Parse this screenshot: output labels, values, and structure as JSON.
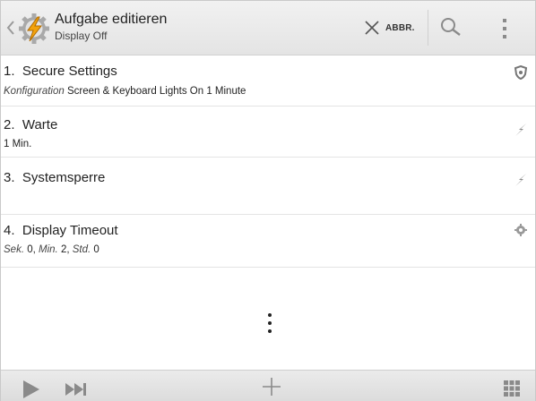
{
  "header": {
    "title": "Aufgabe editieren",
    "subtitle": "Display Off",
    "cancel_label": "ABBR.",
    "icons": [
      "back-chevron-icon",
      "tasker-logo-icon",
      "close-icon",
      "search-icon",
      "overflow-menu-icon"
    ]
  },
  "actions": [
    {
      "number": "1.",
      "title": "Secure Settings",
      "sub_key": "Konfiguration",
      "sub_text": "Screen & Keyboard Lights On 1 Minute",
      "icon": "shield-icon"
    },
    {
      "number": "2.",
      "title": "Warte",
      "sub_text": "1 Min.",
      "icon": "lightning-icon"
    },
    {
      "number": "3.",
      "title": "Systemsperre",
      "icon": "lightning-icon"
    },
    {
      "number": "4.",
      "title": "Display Timeout",
      "sub_parts": [
        "Sek.",
        "0",
        "Min.",
        "2",
        "Std.",
        "0"
      ],
      "icon": "gear-icon"
    }
  ],
  "bottombar": {
    "icons": [
      "play-icon",
      "step-forward-icon",
      "add-icon",
      "grid-icon"
    ]
  },
  "colors": {
    "actionbar_bg": "#e8e8e8",
    "logo_orange": "#f2a20c",
    "icon_gray": "#888888"
  }
}
